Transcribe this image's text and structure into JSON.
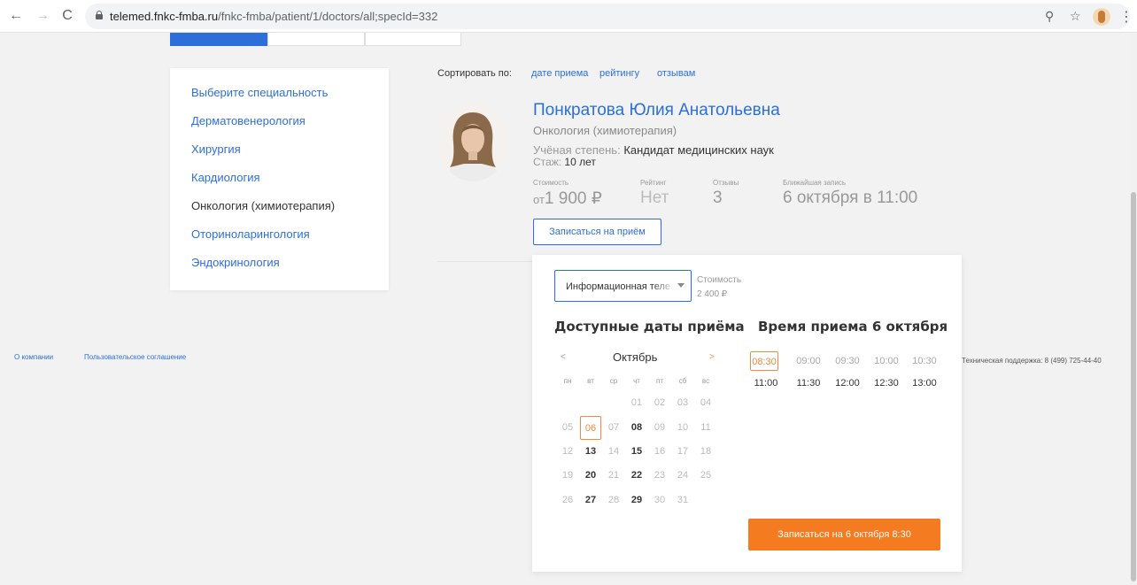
{
  "browser": {
    "url_host": "telemed.fnkc-fmba.ru",
    "url_path": "/fnkc-fmba/patient/1/doctors/all;specId=332"
  },
  "sidebar": {
    "items": [
      {
        "label": "Выберите специальность"
      },
      {
        "label": "Дерматовенерология"
      },
      {
        "label": "Хирургия"
      },
      {
        "label": "Кардиология"
      },
      {
        "label": "Онкология (химиотерапия)"
      },
      {
        "label": "Оториноларингология"
      },
      {
        "label": "Эндокринология"
      }
    ]
  },
  "sort": {
    "label": "Сортировать по:",
    "options": [
      "дате приема",
      "рейтингу",
      "отзывам"
    ]
  },
  "doctor": {
    "name": "Понкратова Юлия Анатольевна",
    "specialty": "Онкология (химиотерапия)",
    "degree_label": "Учёная степень: ",
    "degree_value": "Кандидат медицинских наук",
    "experience_label": "Стаж: ",
    "experience_value": "10 лет",
    "stats": {
      "cost_label": "Стоимость",
      "cost_prefix": "от",
      "cost_value": "1 900 ₽",
      "rating_label": "Рейтинг",
      "rating_value": "Нет",
      "reviews_label": "Отзывы",
      "reviews_value": "3",
      "nearest_label": "Ближайшая запись",
      "nearest_value": "6 октября в 11:00"
    },
    "book_button": "Записаться на приём"
  },
  "booking": {
    "service_select": "Информационная телемедицинская консультация",
    "cost_label": "Стоимость",
    "cost_value": "2 400 ₽",
    "dates_heading": "Доступные даты приёма",
    "times_heading": "Время приема 6 октября",
    "calendar": {
      "prev": "<",
      "next": ">",
      "month": "Октябрь",
      "weekdays": [
        "пн",
        "вт",
        "ср",
        "чт",
        "пт",
        "сб",
        "вс"
      ],
      "weeks": [
        [
          null,
          null,
          null,
          {
            "d": "01",
            "avail": false
          },
          {
            "d": "02",
            "avail": false
          },
          {
            "d": "03",
            "avail": false
          },
          {
            "d": "04",
            "avail": false
          }
        ],
        [
          {
            "d": "05",
            "avail": false
          },
          {
            "d": "06",
            "avail": true,
            "selected": true
          },
          {
            "d": "07",
            "avail": false
          },
          {
            "d": "08",
            "avail": true
          },
          {
            "d": "09",
            "avail": false
          },
          {
            "d": "10",
            "avail": false
          },
          {
            "d": "11",
            "avail": false
          }
        ],
        [
          {
            "d": "12",
            "avail": false
          },
          {
            "d": "13",
            "avail": true
          },
          {
            "d": "14",
            "avail": false
          },
          {
            "d": "15",
            "avail": true
          },
          {
            "d": "16",
            "avail": false
          },
          {
            "d": "17",
            "avail": false
          },
          {
            "d": "18",
            "avail": false
          }
        ],
        [
          {
            "d": "19",
            "avail": false
          },
          {
            "d": "20",
            "avail": true
          },
          {
            "d": "21",
            "avail": false
          },
          {
            "d": "22",
            "avail": true
          },
          {
            "d": "23",
            "avail": false
          },
          {
            "d": "24",
            "avail": false
          },
          {
            "d": "25",
            "avail": false
          }
        ],
        [
          {
            "d": "26",
            "avail": false
          },
          {
            "d": "27",
            "avail": true
          },
          {
            "d": "28",
            "avail": false
          },
          {
            "d": "29",
            "avail": true
          },
          {
            "d": "30",
            "avail": false
          },
          {
            "d": "31",
            "avail": false
          },
          null
        ]
      ]
    },
    "times": [
      [
        {
          "t": "08:30",
          "selected": true
        },
        {
          "t": "09:00"
        },
        {
          "t": "09:30"
        },
        {
          "t": "10:00"
        },
        {
          "t": "10:30"
        }
      ],
      [
        {
          "t": "11:00",
          "dark": true
        },
        {
          "t": "11:30",
          "dark": true
        },
        {
          "t": "12:00",
          "dark": true
        },
        {
          "t": "12:30",
          "dark": true
        },
        {
          "t": "13:00",
          "dark": true
        }
      ]
    ],
    "confirm_button": "Записаться на 6 октября 8:30"
  },
  "footer": {
    "about": "О компании",
    "agreement": "Пользовательское соглашение",
    "support": "Техническая поддержка: 8 (499) 725-44-40"
  },
  "colors": {
    "accent": "#2d6fd8",
    "orange": "#f47b20"
  }
}
